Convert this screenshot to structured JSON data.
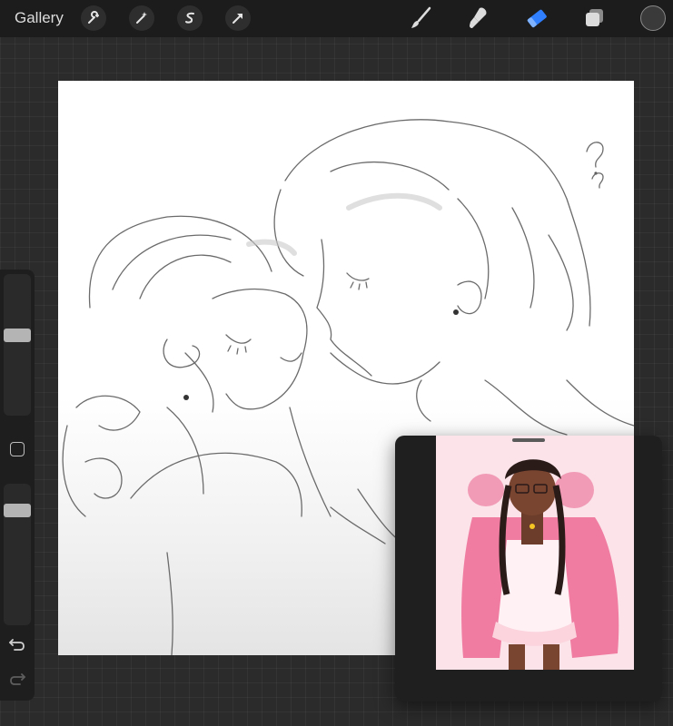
{
  "topbar": {
    "gallery_label": "Gallery",
    "actions": [
      {
        "name": "wrench-icon"
      },
      {
        "name": "magic-wand-icon"
      },
      {
        "name": "selection-icon"
      },
      {
        "name": "transform-arrow-icon"
      }
    ],
    "tools": [
      {
        "name": "brush-icon"
      },
      {
        "name": "smudge-icon"
      },
      {
        "name": "eraser-icon",
        "active": true,
        "color": "#2f7fff"
      },
      {
        "name": "layers-icon"
      }
    ],
    "current_color": "#3a3a3a"
  },
  "sidebar": {
    "brush_size_level": 0.45,
    "opacity_level": 0.18,
    "icons": [
      "modify-square-icon",
      "undo-icon",
      "redo-icon"
    ]
  },
  "reference_panel": {
    "image": "reference-artwork"
  },
  "colors": {
    "topbar": "#1c1c1c",
    "background": "#2b2b2b",
    "accent": "#2f7fff",
    "reference_bg": "#fbe3e9"
  }
}
